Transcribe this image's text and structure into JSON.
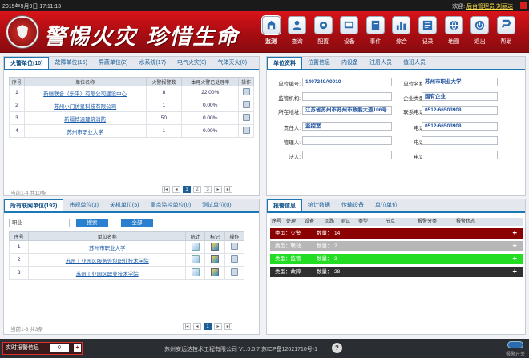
{
  "topbar": {
    "datetime": "2015年9月9日 17:11:13",
    "welcome": "欢迎:",
    "user_link": "后台管理员 刘丽达"
  },
  "header": {
    "slogan": "警惕火灾 珍惜生命"
  },
  "nav": [
    {
      "label": "监测",
      "icon": "building-icon"
    },
    {
      "label": "查询",
      "icon": "user-icon"
    },
    {
      "label": "配置",
      "icon": "gear-icon"
    },
    {
      "label": "设备",
      "icon": "device-icon"
    },
    {
      "label": "事件",
      "icon": "event-icon"
    },
    {
      "label": "综合",
      "icon": "chart-icon"
    },
    {
      "label": "记录",
      "icon": "record-icon"
    },
    {
      "label": "地图",
      "icon": "globe-icon"
    },
    {
      "label": "退出",
      "icon": "power-icon"
    },
    {
      "label": "帮助",
      "icon": "help-icon"
    }
  ],
  "units_panel": {
    "tabs": [
      "火警单位(10)",
      "故障单位(16)",
      "屏蔽单位(2)",
      "水系统(17)",
      "电气火灾(0)",
      "气体灭火(0)"
    ],
    "headers": [
      "序号",
      "单位名称",
      "火警报警数",
      "本月火警已处理率",
      "操作"
    ],
    "rows": [
      [
        "1",
        "新疆联合（乐平）有限公司建设中心",
        "8",
        "22.00%"
      ],
      [
        "2",
        "苏州小门仿星科技有限公司",
        "1",
        "0.00%"
      ],
      [
        "3",
        "新疆博远建筑消防",
        "50",
        "0.00%"
      ],
      [
        "4",
        "苏州市职业大学",
        "1",
        "0.00%"
      ]
    ],
    "footer": "当前1-4 共10条",
    "pages": [
      "1",
      "2",
      "3"
    ],
    "current_page": "1"
  },
  "detail_panel": {
    "tabs": [
      "单位资料",
      "位置信息",
      "内设备",
      "注册人员",
      "值班人员"
    ],
    "fields": {
      "unit_code_label": "单位编号:",
      "unit_code": "1407240A0010",
      "unit_name_label": "单位名称:",
      "unit_name": "苏州市职业大学",
      "org_label": "监管机构:",
      "org": "",
      "type_label": "企业类型:",
      "type": "国有企业",
      "addr_label": "所在地址:",
      "addr": "江苏省苏州市苏州市致能大道106号",
      "phone_label": "联系电话:",
      "phone": "0512-66503908",
      "owner_label": "责任人:",
      "owner": "监控室",
      "owner_phone_label": "电话:",
      "owner_phone": "0512-66503908",
      "manager_label": "管理人:",
      "manager": "",
      "manager_phone_label": "电话:",
      "manager_phone": "",
      "legal_label": "法人:",
      "legal": "",
      "legal_phone_label": "电话:",
      "legal_phone": ""
    }
  },
  "network_panel": {
    "tabs": [
      "所有联网单位(192)",
      "违规单位(3)",
      "关机单位(5)",
      "重点监控单位(0)",
      "测试单位(0)"
    ],
    "search_value": "职业",
    "search_btn": "搜索",
    "all_btn": "全部",
    "headers": [
      "序号",
      "单位名称",
      "统计",
      "标记",
      "操作"
    ],
    "rows": [
      [
        "1",
        "苏州市职业大学"
      ],
      [
        "2",
        "苏州工业园区服务外包职业技术学院"
      ],
      [
        "3",
        "苏州工业园区职业技术学院"
      ]
    ],
    "footer": "当前1-3 共3条",
    "current_page": "1"
  },
  "alarm_panel": {
    "tabs": [
      "报警信息",
      "统计数据",
      "传输设备",
      "单位单位"
    ],
    "headers": [
      "序号",
      "处理",
      "设备",
      "回路",
      "测试",
      "类型",
      "节点",
      "报警分类",
      "报警状态"
    ],
    "rows": [
      {
        "label": "类型：火警",
        "count_label": "数量：",
        "count": "14",
        "bg": "#8b0000"
      },
      {
        "label": "类型：联动",
        "count_label": "数量：",
        "count": "2",
        "bg": "#b7b7b7"
      },
      {
        "label": "类型：监管",
        "count_label": "数量：",
        "count": "3",
        "bg": "#22dd22"
      },
      {
        "label": "类型：故障",
        "count_label": "数量：",
        "count": "28",
        "bg": "#2f2f2f"
      }
    ]
  },
  "bottombar": {
    "alert_label": "实时报警信息",
    "alert_count": "0",
    "copyright": "苏州安远达技术工程有限公司 V1.0.0.7 苏ICP备12021710号-1",
    "sound_label": "报警开关"
  }
}
